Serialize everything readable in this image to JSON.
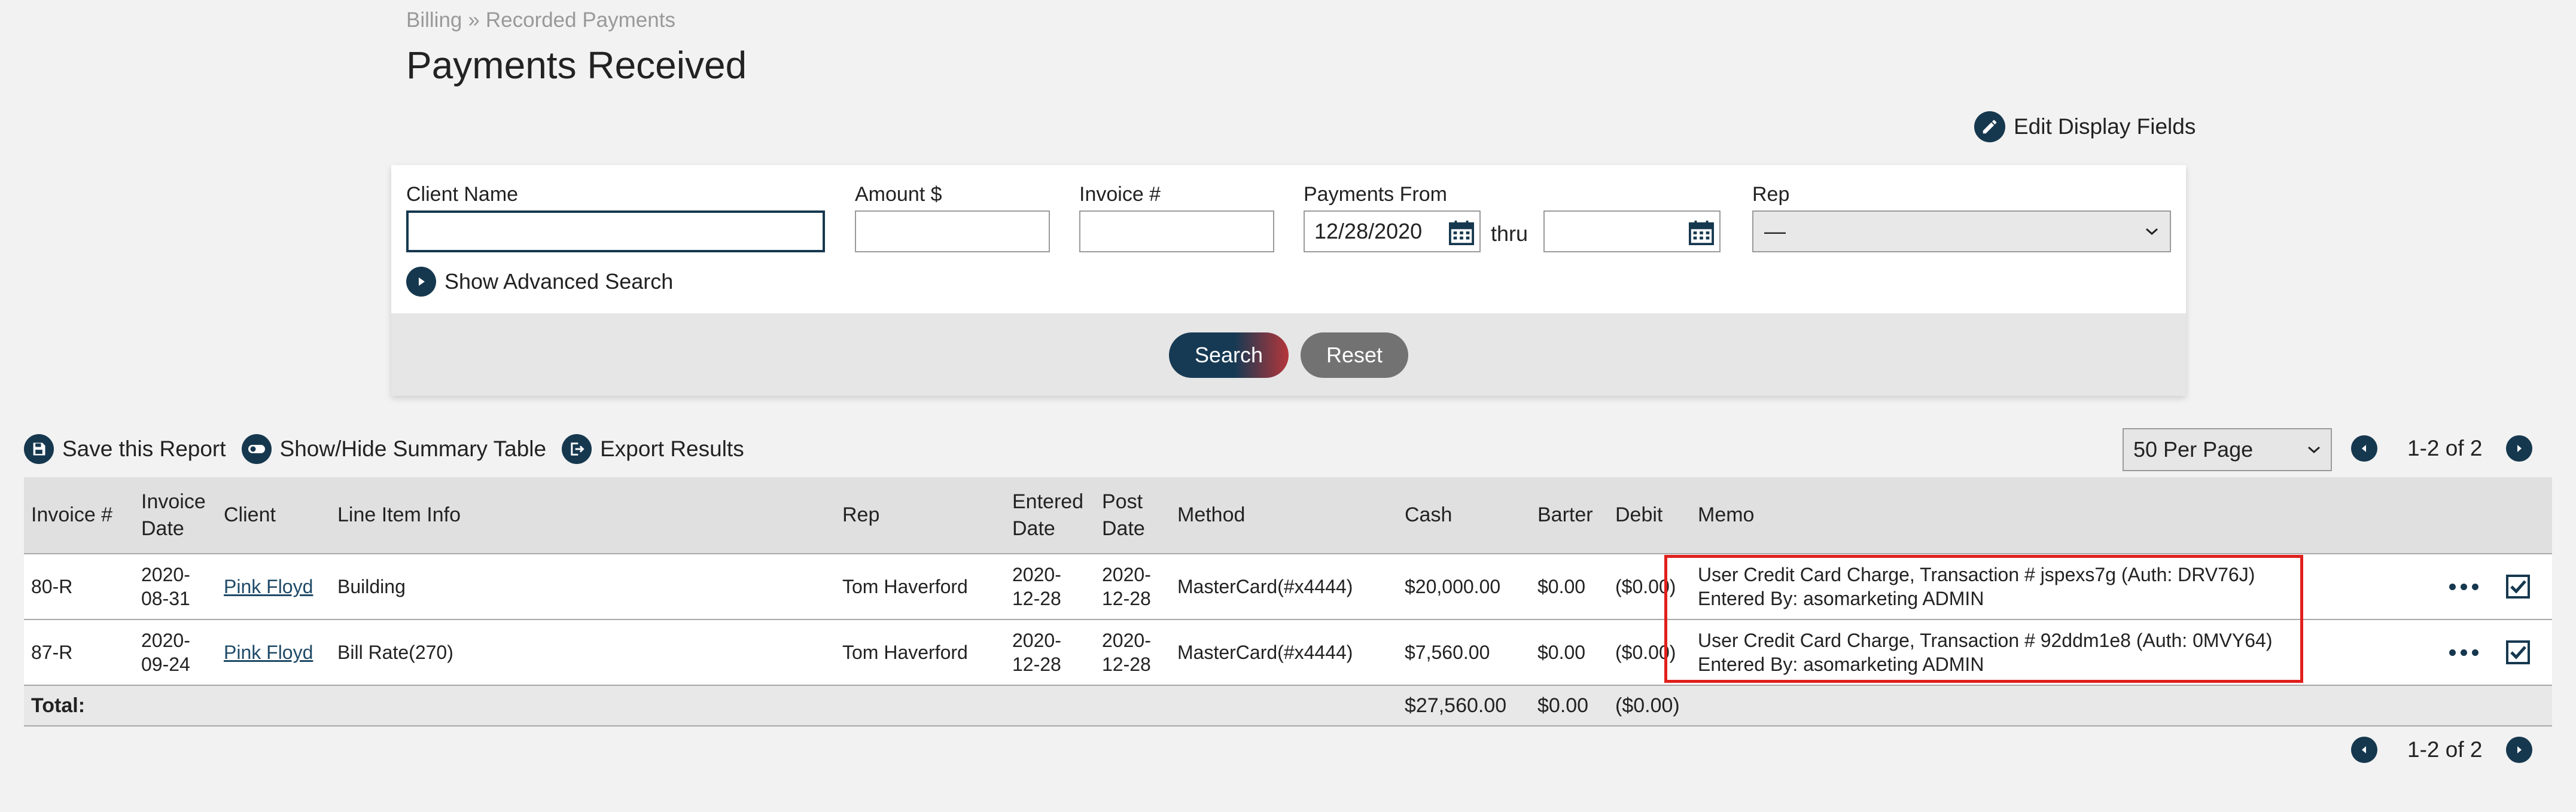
{
  "breadcrumb": {
    "parent": "Billing",
    "separator": "»",
    "current": "Recorded Payments"
  },
  "page_title": "Payments Received",
  "edit_display_fields": "Edit Display Fields",
  "search": {
    "client_name_label": "Client Name",
    "client_name_value": "",
    "amount_label": "Amount $",
    "amount_value": "",
    "invoice_label": "Invoice #",
    "invoice_value": "",
    "payments_from_label": "Payments From",
    "payments_from_value": "12/28/2020",
    "thru_label": "thru",
    "thru_value": "",
    "rep_label": "Rep",
    "rep_value": "—",
    "show_advanced": "Show Advanced Search",
    "search_button": "Search",
    "reset_button": "Reset"
  },
  "toolbar": {
    "save_report": "Save this Report",
    "toggle_summary": "Show/Hide Summary Table",
    "export": "Export Results"
  },
  "pagination": {
    "per_page": "50 Per Page",
    "count": "1-2 of 2"
  },
  "table": {
    "headers": {
      "invoice": "Invoice #",
      "invoice_date": "Invoice Date",
      "client": "Client",
      "line_item": "Line Item Info",
      "rep": "Rep",
      "entered_date": "Entered Date",
      "post_date": "Post Date",
      "method": "Method",
      "cash": "Cash",
      "barter": "Barter",
      "debit": "Debit",
      "memo": "Memo"
    },
    "rows": [
      {
        "invoice": "80-R",
        "invoice_date": "2020-08-31",
        "client": "Pink Floyd",
        "line_item": "Building",
        "rep": "Tom Haverford",
        "entered_date": "2020-12-28",
        "post_date": "2020-12-28",
        "method": "MasterCard(#x4444)",
        "cash": "$20,000.00",
        "barter": "$0.00",
        "debit": "($0.00)",
        "memo_line1": "User Credit Card Charge, Transaction # jspexs7g (Auth: DRV76J)",
        "memo_line2": "Entered By: asomarketing ADMIN"
      },
      {
        "invoice": "87-R",
        "invoice_date": "2020-09-24",
        "client": "Pink Floyd",
        "line_item": "Bill Rate(270)",
        "rep": "Tom Haverford",
        "entered_date": "2020-12-28",
        "post_date": "2020-12-28",
        "method": "MasterCard(#x4444)",
        "cash": "$7,560.00",
        "barter": "$0.00",
        "debit": "($0.00)",
        "memo_line1": "User Credit Card Charge, Transaction # 92ddm1e8 (Auth: 0MVY64)",
        "memo_line2": "Entered By: asomarketing ADMIN"
      }
    ],
    "total": {
      "label": "Total:",
      "cash": "$27,560.00",
      "barter": "$0.00",
      "debit": "($0.00)"
    }
  },
  "colors": {
    "primary": "#16384f",
    "accent": "#b5363a",
    "highlight": "#e0201c",
    "link": "#1f4a68"
  }
}
